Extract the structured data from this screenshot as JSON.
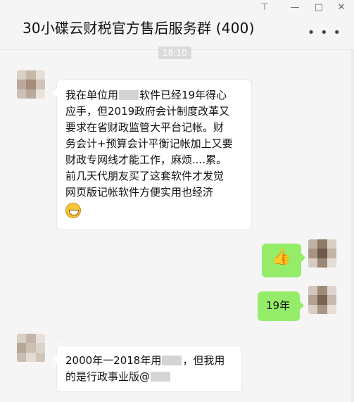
{
  "window": {
    "title": "30小碟云财税官方售后服务群 (400)",
    "pin_icon": "pin-icon",
    "min_icon": "minimize-icon",
    "max_icon": "maximize-icon",
    "close_icon": "close-icon",
    "more_icon": "more-icon"
  },
  "chat": {
    "timestamp": "18:10",
    "messages": [
      {
        "sender": "left",
        "avatar_colors": [
          "#d8cfc8",
          "#c8b8a8",
          "#e6dfd9",
          "#bba89a",
          "#a48c7a",
          "#d1c4bb",
          "#ccc0b5",
          "#b9aa9c",
          "#e8e2dd"
        ],
        "lines": [
          "我在单位用 [redacted] 软件已经19年得心",
          "应手，但2019政府会计制度改革又",
          "要求在省财政监管大平台记帐。财",
          "务会计+预算会计平衡记帐加上又要",
          "财政专网线才能工作，麻烦....累。",
          "前几天代朋友买了这套软件才发觉",
          "网页版记帐软件方便实用也经济"
        ],
        "line_parts": [
          [
            "我在单位用",
            "软件已经19年得心"
          ],
          [
            "应手，但2019政府会计制度改革又"
          ],
          [
            "要求在省财政监管大平台记帐。财"
          ],
          [
            "务会计+预算会计平衡记帐加上又要"
          ],
          [
            "财政专网线才能工作，麻烦....累。"
          ],
          [
            "前几天代朋友买了这套软件才发觉"
          ],
          [
            "网页版记帐软件方便实用也经济"
          ]
        ],
        "emoji": "grin-emoji"
      },
      {
        "sender": "right",
        "content": "👍",
        "emoji_name": "thumbs-up-icon",
        "avatar_colors": [
          "#bfb1a4",
          "#8f7a68",
          "#d9cfc6",
          "#a89483",
          "#6f5a4a",
          "#c4b4a6",
          "#d6ccc3",
          "#9c8676",
          "#e3ddd8"
        ]
      },
      {
        "sender": "right",
        "text": "19年",
        "avatar_colors": [
          "#cfc6be",
          "#a08a78",
          "#ddd5cd",
          "#b3a090",
          "#7a6352",
          "#c7b9ad",
          "#d8cfc6",
          "#a99584",
          "#e6dfd8"
        ]
      },
      {
        "sender": "left",
        "text_parts": [
          "2000年一2018年用",
          "，但我用",
          "的是行政事业版@"
        ],
        "avatar_colors": [
          "#d9cfc5",
          "#c4b6aa",
          "#e8e1da",
          "#b7a696",
          "#cdbfb2",
          "#dcd3ca",
          "#c9bcb0",
          "#e2dbd4",
          "#d0c5bb"
        ]
      }
    ]
  }
}
